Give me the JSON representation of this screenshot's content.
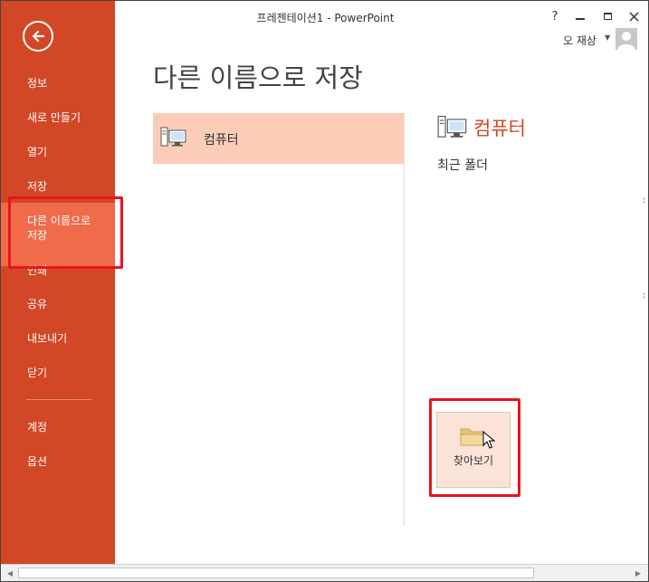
{
  "window": {
    "title": "프레젠테이션1 - PowerPoint",
    "help_label": "?",
    "user_name": "오 재상"
  },
  "sidebar": {
    "items": [
      {
        "label": "정보"
      },
      {
        "label": "새로 만들기"
      },
      {
        "label": "열기"
      },
      {
        "label": "저장"
      },
      {
        "label": "다른 이름으로\n저장",
        "active": true
      },
      {
        "label": "인쇄"
      },
      {
        "label": "공유"
      },
      {
        "label": "내보내기"
      },
      {
        "label": "닫기"
      },
      {
        "label": "계정"
      },
      {
        "label": "옵션"
      }
    ]
  },
  "main": {
    "title": "다른 이름으로 저장",
    "places": [
      {
        "label": "컴퓨터",
        "selected": true
      }
    ],
    "detail": {
      "heading": "컴퓨터",
      "recent_folders_label": "최근 폴더",
      "browse_label": "찾아보기"
    }
  },
  "colors": {
    "accent": "#d24726",
    "sidebar_active": "#f06b4a",
    "selected_place": "#fbcdb8",
    "highlight_box": "#e8141e"
  }
}
